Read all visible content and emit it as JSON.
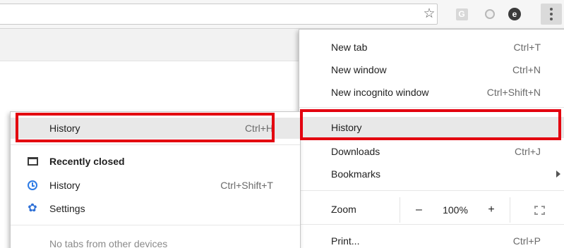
{
  "toolbar": {
    "icons": {
      "star": "star-icon",
      "ext_g": "G",
      "ext_circle": "circle-extension-icon",
      "ext_e": "e",
      "more": "three-dots-menu-icon"
    }
  },
  "main_menu": {
    "items": [
      {
        "label": "New tab",
        "shortcut": "Ctrl+T"
      },
      {
        "label": "New window",
        "shortcut": "Ctrl+N"
      },
      {
        "label": "New incognito window",
        "shortcut": "Ctrl+Shift+N"
      },
      {
        "label": "History",
        "shortcut": ""
      },
      {
        "label": "Downloads",
        "shortcut": "Ctrl+J"
      },
      {
        "label": "Bookmarks",
        "shortcut": ""
      },
      {
        "label": "Print...",
        "shortcut": "Ctrl+P"
      }
    ],
    "zoom": {
      "label": "Zoom",
      "minus": "–",
      "value": "100%",
      "plus": "+"
    }
  },
  "history_submenu": {
    "items": [
      {
        "label": "History",
        "shortcut": "Ctrl+H"
      },
      {
        "label": "Recently closed",
        "shortcut": ""
      },
      {
        "label": "History",
        "shortcut": "Ctrl+Shift+T"
      },
      {
        "label": "Settings",
        "shortcut": ""
      },
      {
        "label": "No tabs from other devices",
        "shortcut": ""
      }
    ]
  },
  "colors": {
    "highlight_box": "#e3000f",
    "item_hover": "#e8e8e8",
    "accent_blue": "#2d7be5"
  }
}
